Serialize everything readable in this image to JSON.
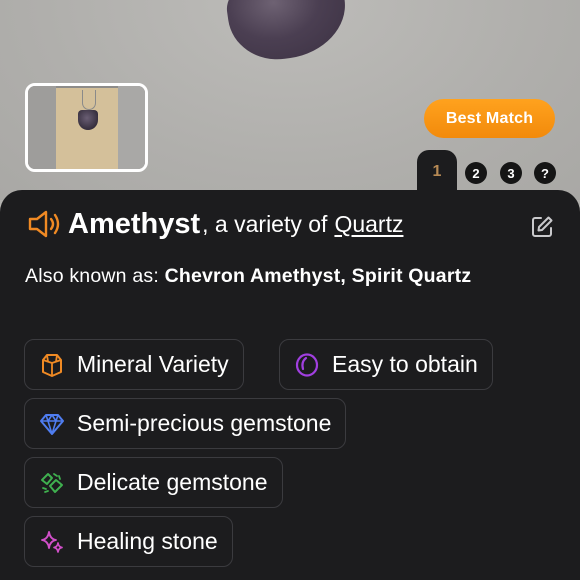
{
  "header": {
    "best_match_label": "Best Match",
    "tabs": [
      {
        "label": "1",
        "active": true
      },
      {
        "label": "2",
        "active": false
      },
      {
        "label": "3",
        "active": false
      },
      {
        "label": "?",
        "active": false
      }
    ]
  },
  "result": {
    "name": "Amethyst",
    "variety_text": ", a variety of",
    "parent_link": "Quartz",
    "also_known_label": "Also known as:",
    "also_known_values": "Chevron Amethyst, Spirit Quartz"
  },
  "chips": [
    {
      "label": "Mineral Variety",
      "icon": "crystal-icon",
      "color": "#f08a24"
    },
    {
      "label": "Easy to obtain",
      "icon": "ring-icon",
      "color": "#a13fe0"
    },
    {
      "label": "Semi-precious gemstone",
      "icon": "diamond-icon",
      "color": "#4f7df0"
    },
    {
      "label": "Delicate gemstone",
      "icon": "broken-gem-icon",
      "color": "#3fb04f"
    },
    {
      "label": "Healing stone",
      "icon": "sparkles-icon",
      "color": "#d14fc9"
    }
  ],
  "colors": {
    "accent_orange": "#f28a0b",
    "panel_bg": "#1c1c1e",
    "active_tab_text": "#b78a55"
  }
}
